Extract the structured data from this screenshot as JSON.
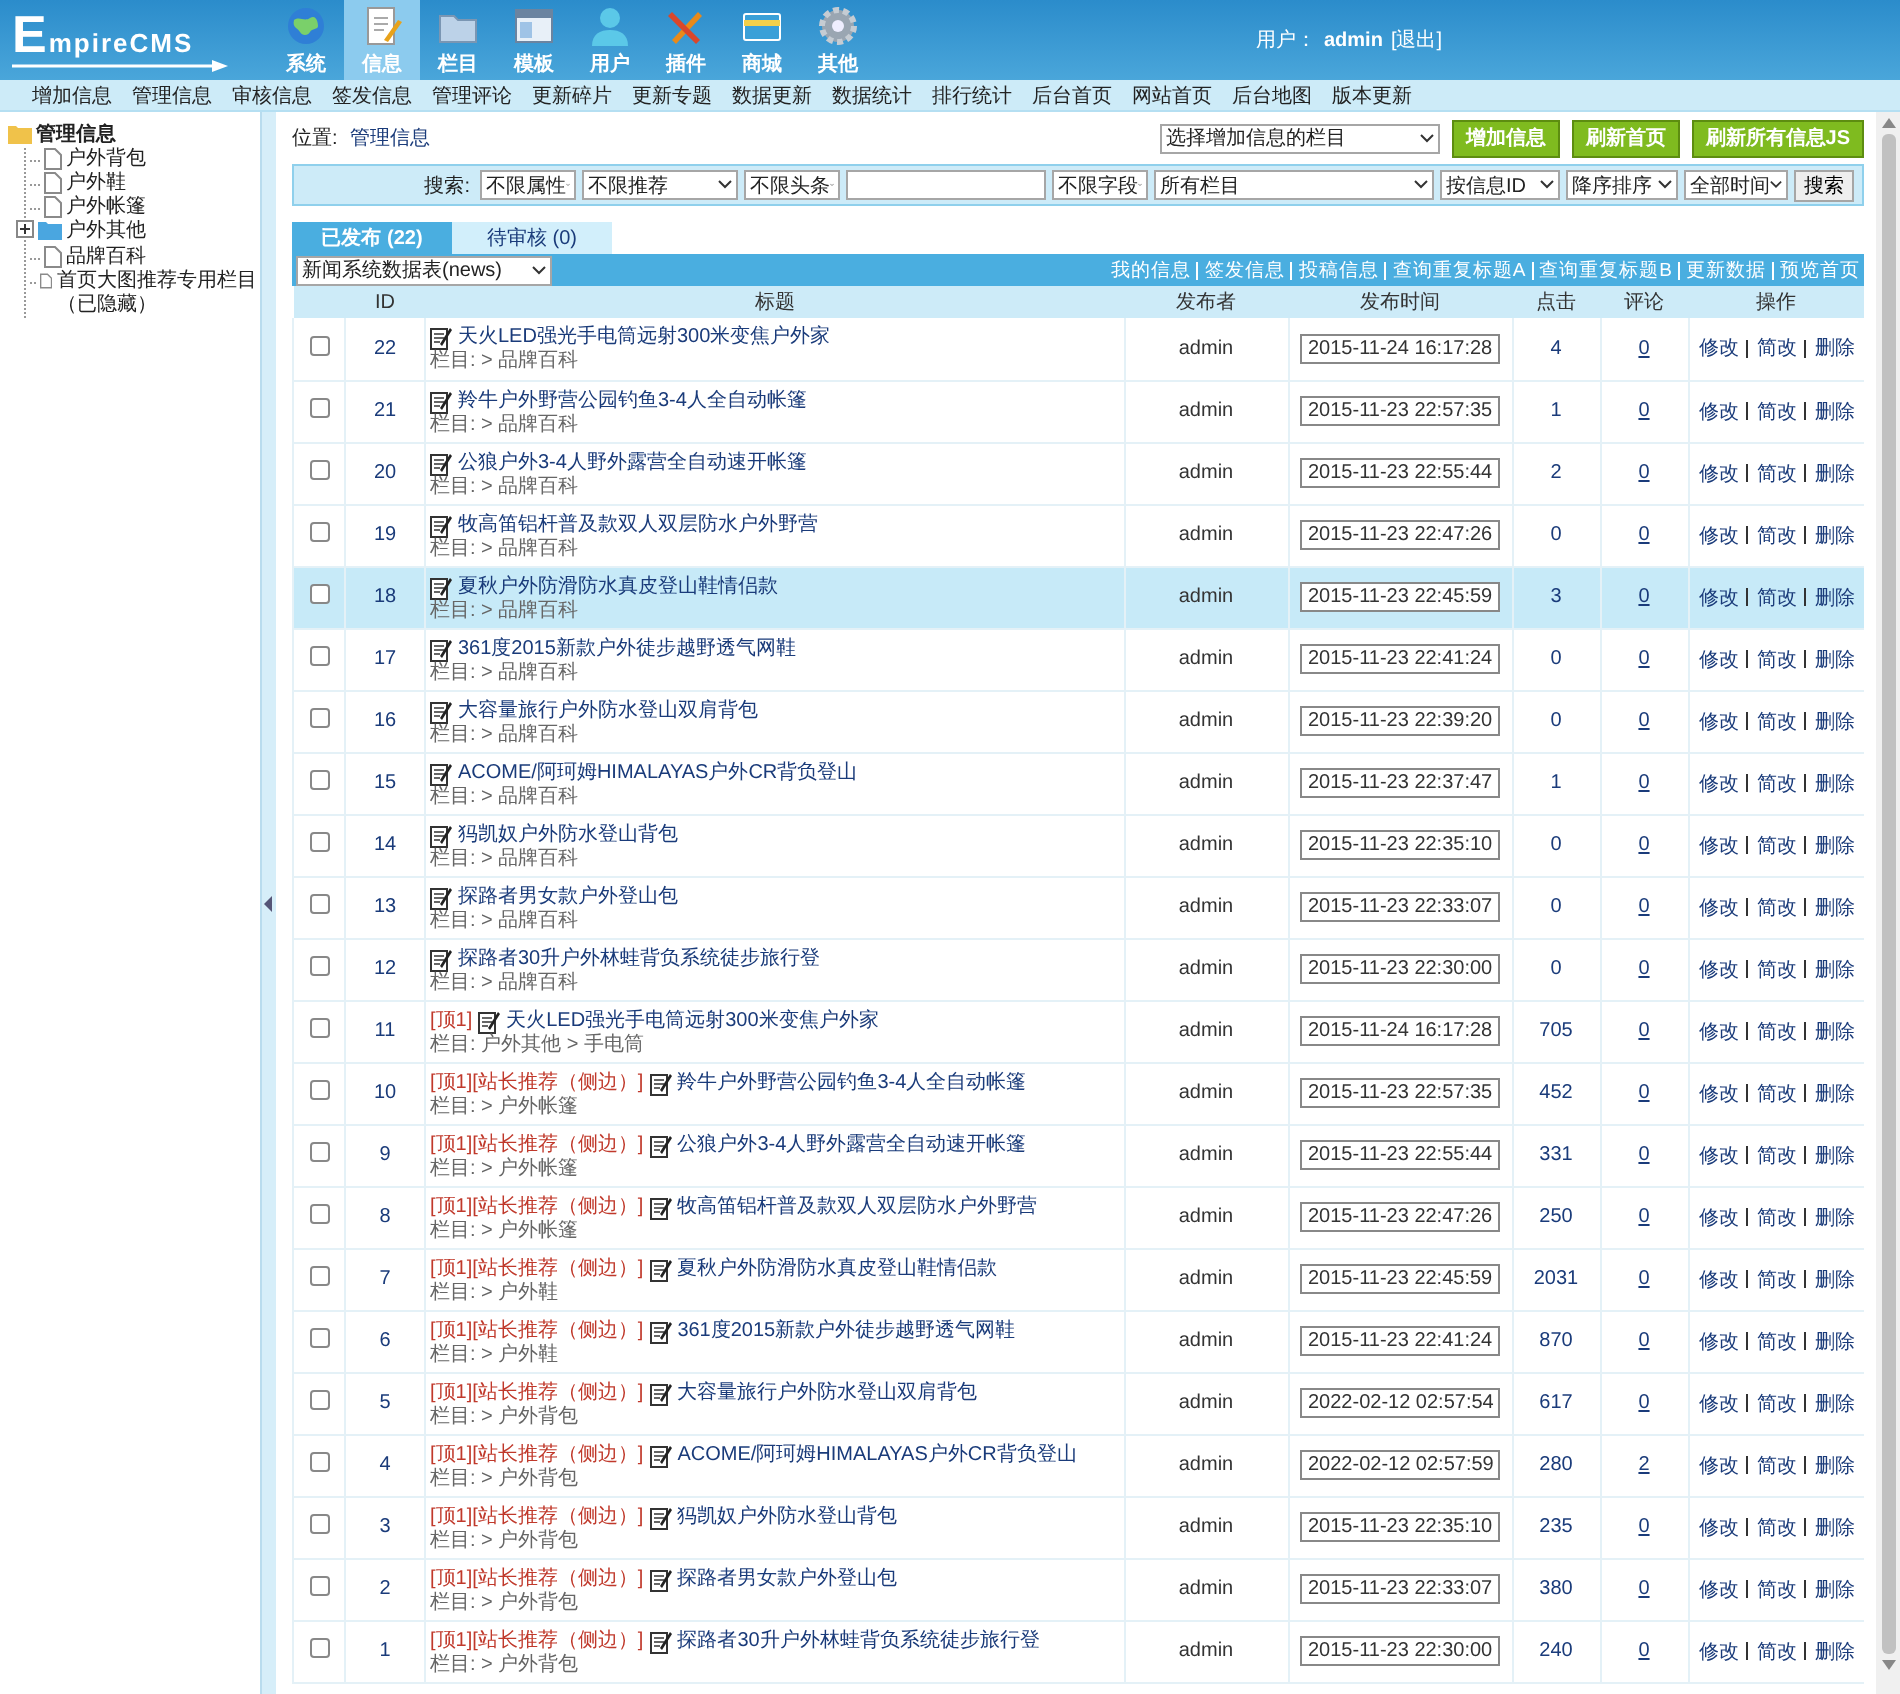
{
  "header": {
    "logo": "EmpireCMS",
    "nav": [
      {
        "label": "系统",
        "selected": false
      },
      {
        "label": "信息",
        "selected": true
      },
      {
        "label": "栏目",
        "selected": false
      },
      {
        "label": "模板",
        "selected": false
      },
      {
        "label": "用户",
        "selected": false
      },
      {
        "label": "插件",
        "selected": false
      },
      {
        "label": "商城",
        "selected": false
      },
      {
        "label": "其他",
        "selected": false
      }
    ],
    "user_label": "用户：",
    "user": "admin",
    "logout": "[退出]"
  },
  "subnav": [
    "增加信息",
    "管理信息",
    "审核信息",
    "签发信息",
    "管理评论",
    "更新碎片",
    "更新专题",
    "数据更新",
    "数据统计",
    "排行统计",
    "后台首页",
    "网站首页",
    "后台地图",
    "版本更新"
  ],
  "sidebar": {
    "root": "管理信息",
    "items": [
      {
        "label": "户外背包",
        "kind": "page"
      },
      {
        "label": "户外鞋",
        "kind": "page"
      },
      {
        "label": "户外帐篷",
        "kind": "page"
      },
      {
        "label": "户外其他",
        "kind": "folder",
        "expanded": false
      },
      {
        "label": "品牌百科",
        "kind": "page"
      },
      {
        "label": "首页大图推荐专用栏目（已隐藏）",
        "kind": "page"
      }
    ]
  },
  "breadcrumb": {
    "label": "位置:",
    "link": "管理信息"
  },
  "add_bar": {
    "select": "选择增加信息的栏目",
    "buttons": [
      "增加信息",
      "刷新首页",
      "刷新所有信息JS"
    ]
  },
  "search": {
    "label": "搜索:",
    "filters": [
      "不限属性",
      "不限推荐",
      "不限头条"
    ],
    "extra_filters": [
      "不限字段",
      "所有栏目",
      "按信息ID",
      "降序排序",
      "全部时间"
    ],
    "button": "搜索"
  },
  "tabs": [
    {
      "label": "已发布 (22)",
      "selected": true
    },
    {
      "label": "待审核 (0)",
      "selected": false
    }
  ],
  "table": {
    "table_select": "新闻系统数据表(news)",
    "links": [
      "我的信息",
      "签发信息",
      "投稿信息",
      "查询重复标题A",
      "查询重复标题B",
      "更新数据",
      "预览首页"
    ],
    "columns": [
      "ID",
      "标题",
      "发布者",
      "发布时间",
      "点击",
      "评论",
      "操作"
    ],
    "rows": [
      {
        "id": "22",
        "title": "天火LED强光手电筒远射300米变焦户外家",
        "category": "栏目: > 品牌百科",
        "author": "admin",
        "time": "2015-11-24 16:17:28",
        "hits": "4",
        "comments": "0",
        "actions": [
          "修改",
          "简改",
          "删除"
        ],
        "checked": false,
        "selected": false
      },
      {
        "id": "21",
        "title": "羚牛户外野营公园钓鱼3-4人全自动帐篷",
        "category": "栏目: > 品牌百科",
        "author": "admin",
        "time": "2015-11-23 22:57:35",
        "hits": "1",
        "comments": "0",
        "actions": [
          "修改",
          "简改",
          "删除"
        ],
        "checked": false,
        "selected": false
      },
      {
        "id": "20",
        "title": "公狼户外3-4人野外露营全自动速开帐篷",
        "category": "栏目: > 品牌百科",
        "author": "admin",
        "time": "2015-11-23 22:55:44",
        "hits": "2",
        "comments": "0",
        "actions": [
          "修改",
          "简改",
          "删除"
        ],
        "checked": false,
        "selected": false
      },
      {
        "id": "19",
        "title": "牧高笛铝杆普及款双人双层防水户外野营",
        "category": "栏目: > 品牌百科",
        "author": "admin",
        "time": "2015-11-23 22:47:26",
        "hits": "0",
        "comments": "0",
        "actions": [
          "修改",
          "简改",
          "删除"
        ],
        "checked": false,
        "selected": false
      },
      {
        "id": "18",
        "title": "夏秋户外防滑防水真皮登山鞋情侣款",
        "category": "栏目: > 品牌百科",
        "author": "admin",
        "time": "2015-11-23 22:45:59",
        "hits": "3",
        "comments": "0",
        "actions": [
          "修改",
          "简改",
          "删除"
        ],
        "checked": false,
        "selected": true
      },
      {
        "id": "17",
        "title": "361度2015新款户外徒步越野透气网鞋",
        "category": "栏目: > 品牌百科",
        "author": "admin",
        "time": "2015-11-23 22:41:24",
        "hits": "0",
        "comments": "0",
        "actions": [
          "修改",
          "简改",
          "删除"
        ],
        "checked": false,
        "selected": false
      },
      {
        "id": "16",
        "title": "大容量旅行户外防水登山双肩背包",
        "category": "栏目: > 品牌百科",
        "author": "admin",
        "time": "2015-11-23 22:39:20",
        "hits": "0",
        "comments": "0",
        "actions": [
          "修改",
          "简改",
          "删除"
        ],
        "checked": false,
        "selected": false
      },
      {
        "id": "15",
        "title": "ACOME/阿珂姆HIMALAYAS户外CR背负登山",
        "category": "栏目: > 品牌百科",
        "author": "admin",
        "time": "2015-11-23 22:37:47",
        "hits": "1",
        "comments": "0",
        "actions": [
          "修改",
          "简改",
          "删除"
        ],
        "checked": false,
        "selected": false
      },
      {
        "id": "14",
        "title": "犸凯奴户外防水登山背包",
        "category": "栏目: > 品牌百科",
        "author": "admin",
        "time": "2015-11-23 22:35:10",
        "hits": "0",
        "comments": "0",
        "actions": [
          "修改",
          "简改",
          "删除"
        ],
        "checked": false,
        "selected": false
      },
      {
        "id": "13",
        "title": "探路者男女款户外登山包",
        "category": "栏目: > 品牌百科",
        "author": "admin",
        "time": "2015-11-23 22:33:07",
        "hits": "0",
        "comments": "0",
        "actions": [
          "修改",
          "简改",
          "删除"
        ],
        "checked": false,
        "selected": false
      },
      {
        "id": "12",
        "title": "探路者30升户外林蛙背负系统徒步旅行登",
        "category": "栏目: > 品牌百科",
        "author": "admin",
        "time": "2015-11-23 22:30:00",
        "hits": "0",
        "comments": "0",
        "actions": [
          "修改",
          "简改",
          "删除"
        ],
        "checked": false,
        "selected": false
      },
      {
        "id": "11",
        "prefix": "[顶1]",
        "title": "天火LED强光手电筒远射300米变焦户外家",
        "category": "栏目: 户外其他 > 手电筒",
        "author": "admin",
        "time": "2015-11-24 16:17:28",
        "hits": "705",
        "comments": "0",
        "actions": [
          "修改",
          "简改",
          "删除"
        ],
        "checked": false,
        "selected": false
      },
      {
        "id": "10",
        "prefix": "[顶1][站长推荐（侧边）]",
        "title": "羚牛户外野营公园钓鱼3-4人全自动帐篷",
        "category": "栏目: > 户外帐篷",
        "author": "admin",
        "time": "2015-11-23 22:57:35",
        "hits": "452",
        "comments": "0",
        "actions": [
          "修改",
          "简改",
          "删除"
        ],
        "checked": false,
        "selected": false
      },
      {
        "id": "9",
        "prefix": "[顶1][站长推荐（侧边）]",
        "title": "公狼户外3-4人野外露营全自动速开帐篷",
        "category": "栏目: > 户外帐篷",
        "author": "admin",
        "time": "2015-11-23 22:55:44",
        "hits": "331",
        "comments": "0",
        "actions": [
          "修改",
          "简改",
          "删除"
        ],
        "checked": false,
        "selected": false
      },
      {
        "id": "8",
        "prefix": "[顶1][站长推荐（侧边）]",
        "title": "牧高笛铝杆普及款双人双层防水户外野营",
        "category": "栏目: > 户外帐篷",
        "author": "admin",
        "time": "2015-11-23 22:47:26",
        "hits": "250",
        "comments": "0",
        "actions": [
          "修改",
          "简改",
          "删除"
        ],
        "checked": false,
        "selected": false
      },
      {
        "id": "7",
        "prefix": "[顶1][站长推荐（侧边）]",
        "title": "夏秋户外防滑防水真皮登山鞋情侣款",
        "category": "栏目: > 户外鞋",
        "author": "admin",
        "time": "2015-11-23 22:45:59",
        "hits": "2031",
        "comments": "0",
        "actions": [
          "修改",
          "简改",
          "删除"
        ],
        "checked": false,
        "selected": false
      },
      {
        "id": "6",
        "prefix": "[顶1][站长推荐（侧边）]",
        "title": "361度2015新款户外徒步越野透气网鞋",
        "category": "栏目: > 户外鞋",
        "author": "admin",
        "time": "2015-11-23 22:41:24",
        "hits": "870",
        "comments": "0",
        "actions": [
          "修改",
          "简改",
          "删除"
        ],
        "checked": false,
        "selected": false
      },
      {
        "id": "5",
        "prefix": "[顶1][站长推荐（侧边）]",
        "title": "大容量旅行户外防水登山双肩背包",
        "category": "栏目: > 户外背包",
        "author": "admin",
        "time": "2022-02-12 02:57:54",
        "hits": "617",
        "comments": "0",
        "actions": [
          "修改",
          "简改",
          "删除"
        ],
        "checked": false,
        "selected": false
      },
      {
        "id": "4",
        "prefix": "[顶1][站长推荐（侧边）]",
        "title": "ACOME/阿珂姆HIMALAYAS户外CR背负登山",
        "category": "栏目: > 户外背包",
        "author": "admin",
        "time": "2022-02-12 02:57:59",
        "hits": "280",
        "comments": "2",
        "actions": [
          "修改",
          "简改",
          "删除"
        ],
        "checked": false,
        "selected": false
      },
      {
        "id": "3",
        "prefix": "[顶1][站长推荐（侧边）]",
        "title": "犸凯奴户外防水登山背包",
        "category": "栏目: > 户外背包",
        "author": "admin",
        "time": "2015-11-23 22:35:10",
        "hits": "235",
        "comments": "0",
        "actions": [
          "修改",
          "简改",
          "删除"
        ],
        "checked": false,
        "selected": false
      },
      {
        "id": "2",
        "prefix": "[顶1][站长推荐（侧边）]",
        "title": "探路者男女款户外登山包",
        "category": "栏目: > 户外背包",
        "author": "admin",
        "time": "2015-11-23 22:33:07",
        "hits": "380",
        "comments": "0",
        "actions": [
          "修改",
          "简改",
          "删除"
        ],
        "checked": false,
        "selected": false
      },
      {
        "id": "1",
        "prefix": "[顶1][站长推荐（侧边）]",
        "title": "探路者30升户外林蛙背负系统徒步旅行登",
        "category": "栏目: > 户外背包",
        "author": "admin",
        "time": "2015-11-23 22:30:00",
        "hits": "240",
        "comments": "0",
        "actions": [
          "修改",
          "简改",
          "删除"
        ],
        "checked": false,
        "selected": false
      }
    ]
  }
}
